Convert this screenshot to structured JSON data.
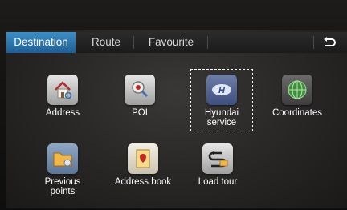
{
  "tabs": [
    {
      "label": "Destination",
      "active": true
    },
    {
      "label": "Route",
      "active": false
    },
    {
      "label": "Favourite",
      "active": false
    }
  ],
  "back_button": {
    "icon": "back-arrow-icon"
  },
  "menu": [
    {
      "label": "Address",
      "icon": "house-icon"
    },
    {
      "label": "POI",
      "icon": "poi-icon"
    },
    {
      "label": "Hyundai\nservice",
      "icon": "hyundai-logo-icon",
      "selected": true
    },
    {
      "label": "Coordinates",
      "icon": "globe-icon"
    },
    {
      "label": "Previous\npoints",
      "icon": "folder-icon"
    },
    {
      "label": "Address book",
      "icon": "address-book-icon"
    },
    {
      "label": "Load tour",
      "icon": "load-tour-icon"
    }
  ],
  "colors": {
    "active_tab": "#2f7bb5",
    "text": "#ffffff"
  }
}
